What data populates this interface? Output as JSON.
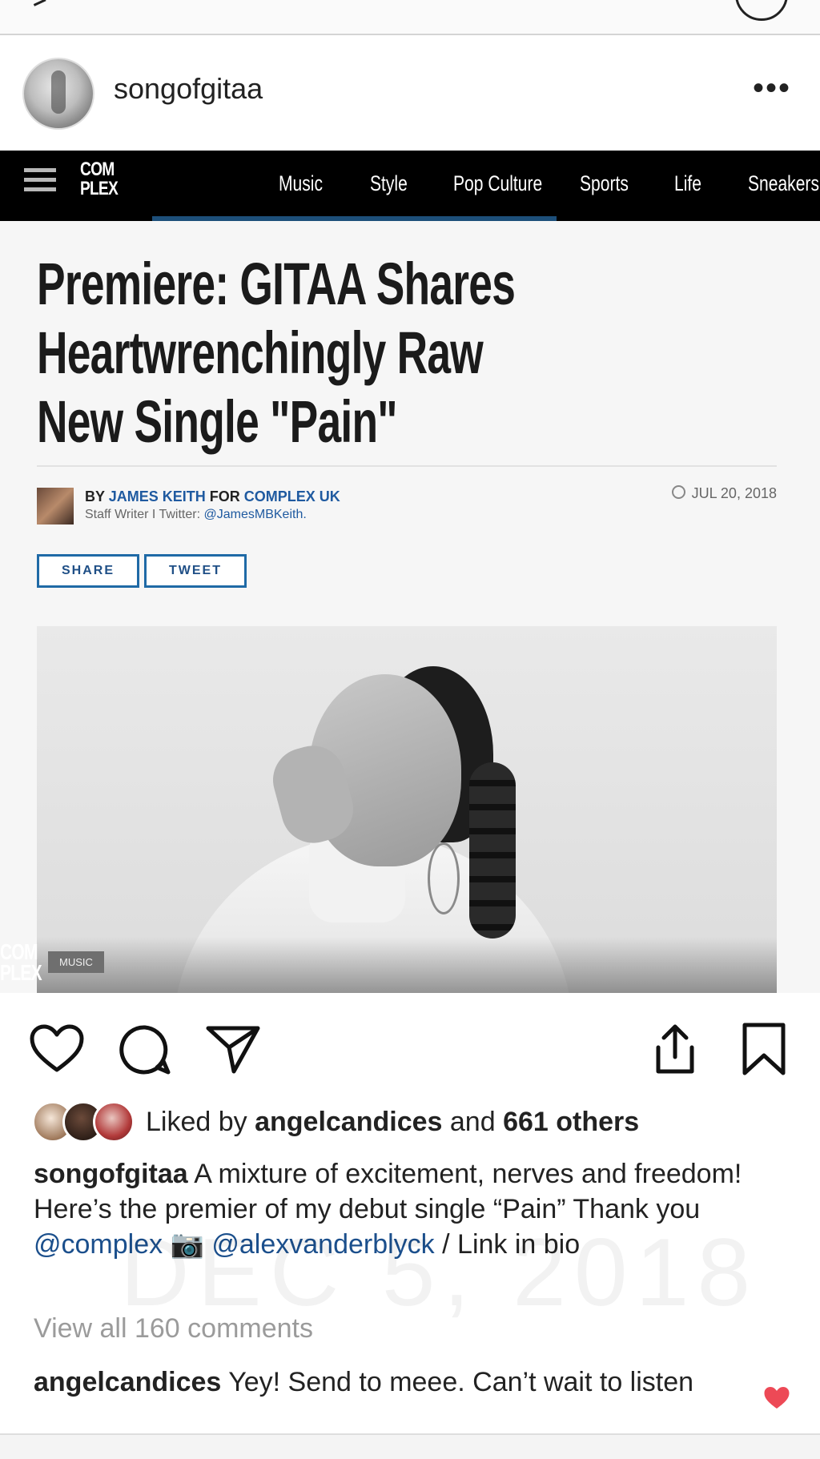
{
  "post": {
    "username": "songofgitaa",
    "more_icon": "•••"
  },
  "complex_nav": {
    "logo": "COM PLEX",
    "links": [
      "Music",
      "Style",
      "Pop Culture",
      "Sports",
      "Life",
      "Sneakers"
    ]
  },
  "article": {
    "headline": "Premiere: GITAA Shares Heartwrenchingly Raw New Single \"Pain\"",
    "by": "BY",
    "author": "JAMES KEITH",
    "for": "FOR",
    "outlet": "COMPLEX UK",
    "staff_prefix": "Staff Writer I Twitter:",
    "twitter": "@JamesMBKeith.",
    "date": "JUL 20, 2018",
    "share": "SHARE",
    "tweet": "TWEET",
    "photo_logo": "COM PLEX",
    "badge": "MUSIC"
  },
  "likes": {
    "prefix": "Liked by",
    "user": "angelcandices",
    "middle": "and",
    "others": "661 others"
  },
  "caption": {
    "user": "songofgitaa",
    "text_1": "A mixture of excitement, nerves and freedom! Here’s the premier of my debut single “Pain” Thank you",
    "mention_1": "@complex",
    "camera": "📷",
    "mention_2": "@alexvanderblyck",
    "text_2": "/ Link in bio"
  },
  "watermark": "DEC 5, 2018",
  "view_all": "View all 160 comments",
  "comment": {
    "user": "angelcandices",
    "text": "Yey! Send to meee. Can’t wait to listen"
  }
}
